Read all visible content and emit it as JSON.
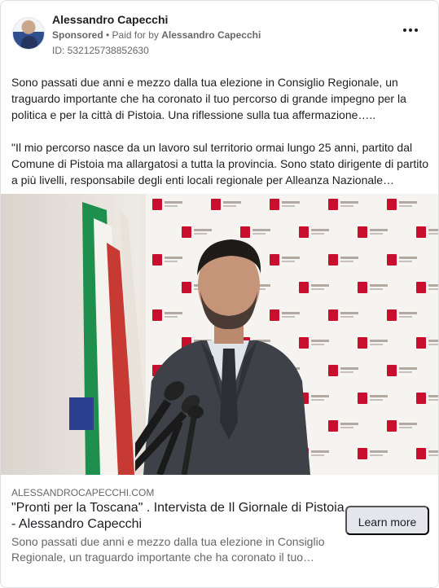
{
  "post": {
    "author": "Alessandro Capecchi",
    "sponsored_label": "Sponsored",
    "separator": " • ",
    "paid_for_prefix": "Paid for by ",
    "paid_for_name": "Alessandro Capecchi",
    "ad_id": "ID: 532125738852630",
    "more_icon": "more-horizontal-icon",
    "paragraph_1": "Sono passati due anni e mezzo dalla tua elezione in Consiglio Regionale, un traguardo importante che ha coronato il tuo percorso di grande impegno per la politica e per la città di Pistoia. Una riflessione sulla tua affermazione…..",
    "paragraph_2": "\"Il mio percorso nasce da un lavoro sul territorio ormai lungo 25 anni, partito dal Comune di Pistoia ma allargatosi a tutta la provincia. Sono stato dirigente di partito a più livelli, responsabile degli enti locali regionale per Alleanza Nazionale…"
  },
  "link": {
    "domain": "ALESSANDROCAPECCHI.COM",
    "title": "\"Pronti per la Toscana\" . Intervista de Il Giornale di Pistoia - Alessandro Capecchi",
    "description": "Sono passati due anni e mezzo dalla tua elezione in Consiglio Regionale, un traguardo importante che ha coronato il tuo…",
    "cta_label": "Learn more"
  },
  "colors": {
    "text_primary": "#1c1e21",
    "text_secondary": "#65676b",
    "button_bg": "#e4e6eb",
    "regione_red": "#c8102e"
  }
}
